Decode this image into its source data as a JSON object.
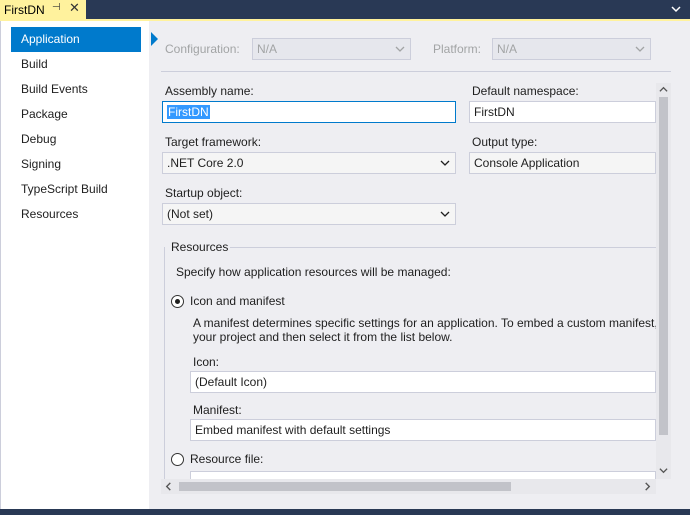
{
  "tab": {
    "title": "FirstDN",
    "pin_glyph": "⊣",
    "close_glyph": "✕"
  },
  "nav": {
    "items": [
      {
        "label": "Application"
      },
      {
        "label": "Build"
      },
      {
        "label": "Build Events"
      },
      {
        "label": "Package"
      },
      {
        "label": "Debug"
      },
      {
        "label": "Signing"
      },
      {
        "label": "TypeScript Build"
      },
      {
        "label": "Resources"
      }
    ],
    "selected": "Application"
  },
  "config": {
    "configuration_label": "Configuration:",
    "configuration_value": "N/A",
    "platform_label": "Platform:",
    "platform_value": "N/A"
  },
  "form": {
    "assembly_name_label": "Assembly name:",
    "assembly_name_value": "FirstDN",
    "default_namespace_label": "Default namespace:",
    "default_namespace_value": "FirstDN",
    "target_framework_label": "Target framework:",
    "target_framework_value": ".NET Core 2.0",
    "output_type_label": "Output type:",
    "output_type_value": "Console Application",
    "startup_object_label": "Startup object:",
    "startup_object_value": "(Not set)"
  },
  "resources": {
    "group_label": "Resources",
    "description": "Specify how application resources will be managed:",
    "icon_manifest_option": "Icon and manifest",
    "manifest_desc_line1": "A manifest determines specific settings for an application. To embed a custom manifest,",
    "manifest_desc_line2": "your project and then select it from the list below.",
    "icon_label": "Icon:",
    "icon_value": "(Default Icon)",
    "manifest_label": "Manifest:",
    "manifest_value": "Embed manifest with default settings",
    "resource_file_option": "Resource file:",
    "selected_option": "Icon and manifest"
  },
  "colors": {
    "accent": "#007acc",
    "tab_active": "#fff29d",
    "frame": "#293955",
    "panel": "#eeeef2"
  }
}
